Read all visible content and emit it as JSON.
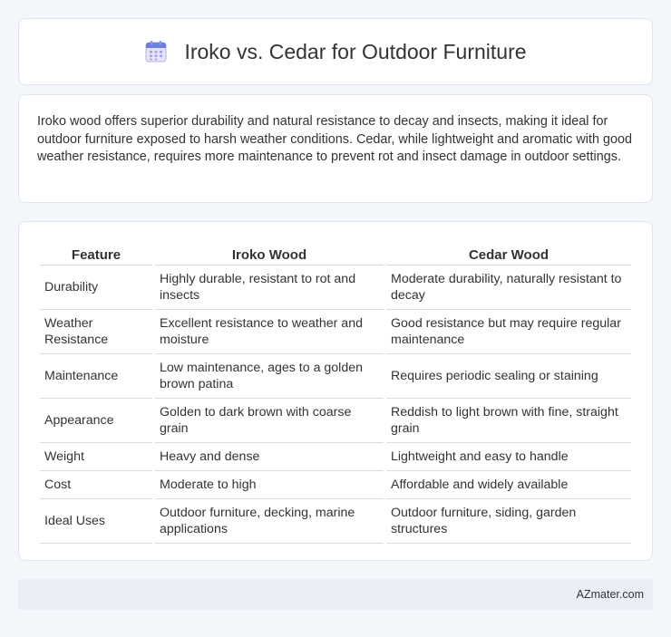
{
  "header": {
    "icon": "calendar-icon",
    "title": "Iroko vs. Cedar for Outdoor Furniture"
  },
  "intro": {
    "text": "Iroko wood offers superior durability and natural resistance to decay and insects, making it ideal for outdoor furniture exposed to harsh weather conditions. Cedar, while lightweight and aromatic with good weather resistance, requires more maintenance to prevent rot and insect damage in outdoor settings."
  },
  "table": {
    "headers": [
      "Feature",
      "Iroko Wood",
      "Cedar Wood"
    ],
    "rows": [
      [
        "Durability",
        "Highly durable, resistant to rot and insects",
        "Moderate durability, naturally resistant to decay"
      ],
      [
        "Weather Resistance",
        "Excellent resistance to weather and moisture",
        "Good resistance but may require regular maintenance"
      ],
      [
        "Maintenance",
        "Low maintenance, ages to a golden brown patina",
        "Requires periodic sealing or staining"
      ],
      [
        "Appearance",
        "Golden to dark brown with coarse grain",
        "Reddish to light brown with fine, straight grain"
      ],
      [
        "Weight",
        "Heavy and dense",
        "Lightweight and easy to handle"
      ],
      [
        "Cost",
        "Moderate to high",
        "Affordable and widely available"
      ],
      [
        "Ideal Uses",
        "Outdoor furniture, decking, marine applications",
        "Outdoor furniture, siding, garden structures"
      ]
    ]
  },
  "footer": {
    "text": "AZmater.com"
  }
}
